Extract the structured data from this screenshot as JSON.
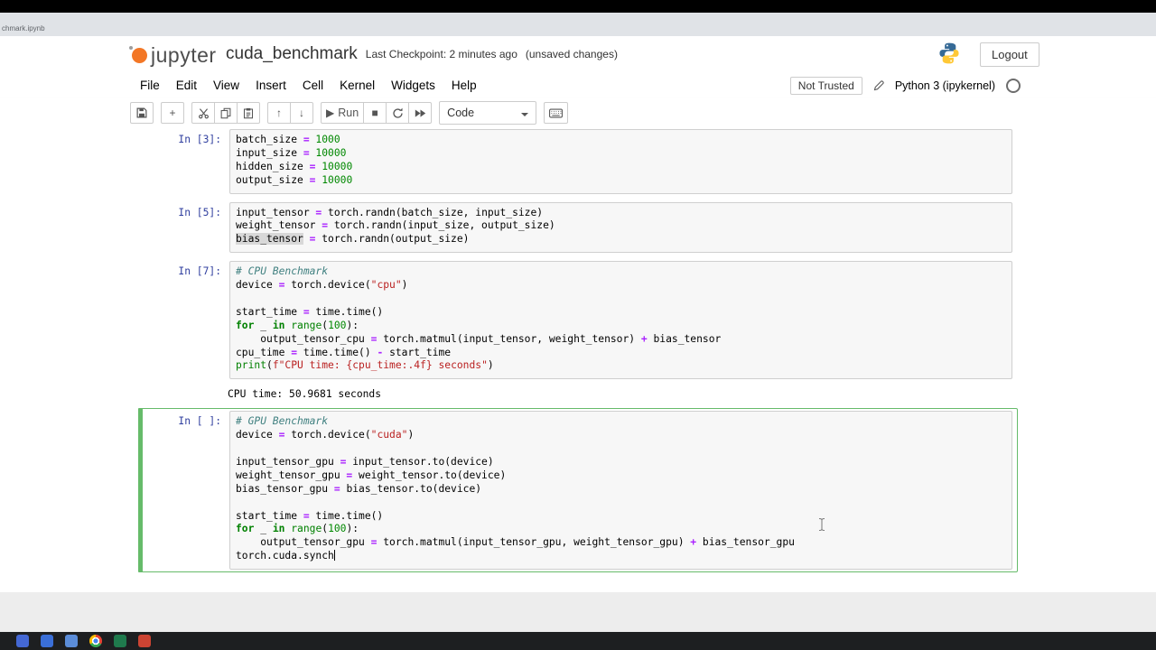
{
  "chrome": {
    "tab_label": "chmark.ipynb"
  },
  "header": {
    "logo_text": "jupyter",
    "title": "cuda_benchmark",
    "checkpoint": "Last Checkpoint: 2 minutes ago",
    "unsaved": "(unsaved changes)",
    "logout_label": "Logout"
  },
  "menu": {
    "items": [
      "File",
      "Edit",
      "View",
      "Insert",
      "Cell",
      "Kernel",
      "Widgets",
      "Help"
    ],
    "trusted_label": "Not Trusted",
    "kernel_name": "Python 3 (ipykernel)"
  },
  "toolbar": {
    "groups": [
      [
        {
          "name": "save-button",
          "icon": "floppy"
        }
      ],
      [
        {
          "name": "insert-cell-button",
          "icon": "plus"
        }
      ],
      [
        {
          "name": "cut-cells-button",
          "icon": "scissors"
        },
        {
          "name": "copy-cells-button",
          "icon": "copy"
        },
        {
          "name": "paste-cells-button",
          "icon": "paste"
        }
      ],
      [
        {
          "name": "move-cell-up-button",
          "icon": "arrow-up"
        },
        {
          "name": "move-cell-down-button",
          "icon": "arrow-down"
        }
      ],
      [
        {
          "name": "run-button",
          "icon": "play",
          "label": "Run"
        },
        {
          "name": "interrupt-kernel-button",
          "icon": "stop"
        },
        {
          "name": "restart-kernel-button",
          "icon": "refresh"
        },
        {
          "name": "restart-run-all-button",
          "icon": "fast-forward"
        }
      ],
      [
        {
          "name": "cell-type-select",
          "type": "select",
          "label": "Code"
        }
      ],
      [
        {
          "name": "command-palette-button",
          "icon": "keyboard"
        }
      ]
    ]
  },
  "colors": {
    "edit_mode_border": "#66BB6A",
    "prompt_blue": "#303F9F",
    "jupyter_orange": "#F37726",
    "keyword_green": "#008000",
    "string_red": "#BA2121",
    "number_green": "#008800",
    "operator_purple": "#AA22FF",
    "comment_teal": "#408080"
  },
  "notebook": {
    "cells": [
      {
        "prompt": "In [3]:",
        "lines": [
          [
            [
              "v",
              "batch_size"
            ],
            [
              "o",
              " = "
            ],
            [
              "n",
              "1000"
            ]
          ],
          [
            [
              "v",
              "input_size"
            ],
            [
              "o",
              " = "
            ],
            [
              "n",
              "10000"
            ]
          ],
          [
            [
              "v",
              "hidden_size"
            ],
            [
              "o",
              " = "
            ],
            [
              "n",
              "10000"
            ]
          ],
          [
            [
              "v",
              "output_size"
            ],
            [
              "o",
              " = "
            ],
            [
              "n",
              "10000"
            ]
          ]
        ]
      },
      {
        "prompt": "In [5]:",
        "lines": [
          [
            [
              "v",
              "input_tensor"
            ],
            [
              "o",
              " = "
            ],
            [
              "v",
              "torch.randn(batch_size, input_size)"
            ]
          ],
          [
            [
              "v",
              "weight_tensor"
            ],
            [
              "o",
              " = "
            ],
            [
              "v",
              "torch.randn(input_size, output_size)"
            ]
          ],
          [
            [
              "hl",
              "bias_tensor"
            ],
            [
              "o",
              " = "
            ],
            [
              "v",
              "torch.randn(output_size)"
            ]
          ]
        ]
      },
      {
        "prompt": "In [7]:",
        "lines": [
          [
            [
              "c",
              "# CPU Benchmark"
            ]
          ],
          [
            [
              "v",
              "device"
            ],
            [
              "o",
              " = "
            ],
            [
              "v",
              "torch.device("
            ],
            [
              "s",
              "\"cpu\""
            ],
            [
              "v",
              ")"
            ]
          ],
          [],
          [
            [
              "v",
              "start_time"
            ],
            [
              "o",
              " = "
            ],
            [
              "v",
              "time.time()"
            ]
          ],
          [
            [
              "k",
              "for"
            ],
            [
              "v",
              " _ "
            ],
            [
              "k",
              "in"
            ],
            [
              "v",
              " "
            ],
            [
              "b",
              "range"
            ],
            [
              "v",
              "("
            ],
            [
              "n",
              "100"
            ],
            [
              "v",
              "):"
            ]
          ],
          [
            [
              "v",
              "    output_tensor_cpu"
            ],
            [
              "o",
              " = "
            ],
            [
              "v",
              "torch.matmul(input_tensor, weight_tensor)"
            ],
            [
              "o",
              " + "
            ],
            [
              "v",
              "bias_tensor"
            ]
          ],
          [
            [
              "v",
              "cpu_time"
            ],
            [
              "o",
              " = "
            ],
            [
              "v",
              "time.time()"
            ],
            [
              "o",
              " - "
            ],
            [
              "v",
              "start_time"
            ]
          ],
          [
            [
              "b",
              "print"
            ],
            [
              "v",
              "("
            ],
            [
              "s",
              "f\"CPU time: {cpu_time:.4f} seconds\""
            ],
            [
              "v",
              ")"
            ]
          ]
        ],
        "output": "CPU time: 50.9681 seconds"
      },
      {
        "prompt": "In [ ]:",
        "selected": true,
        "cursor": true,
        "lines": [
          [
            [
              "c",
              "# GPU Benchmark"
            ]
          ],
          [
            [
              "v",
              "device"
            ],
            [
              "o",
              " = "
            ],
            [
              "v",
              "torch.device("
            ],
            [
              "s",
              "\"cuda\""
            ],
            [
              "v",
              ")"
            ]
          ],
          [],
          [
            [
              "v",
              "input_tensor_gpu"
            ],
            [
              "o",
              " = "
            ],
            [
              "v",
              "input_tensor.to(device)"
            ]
          ],
          [
            [
              "v",
              "weight_tensor_gpu"
            ],
            [
              "o",
              " = "
            ],
            [
              "v",
              "weight_tensor.to(device)"
            ]
          ],
          [
            [
              "v",
              "bias_tensor_gpu"
            ],
            [
              "o",
              " = "
            ],
            [
              "v",
              "bias_tensor.to(device)"
            ]
          ],
          [],
          [
            [
              "v",
              "start_time"
            ],
            [
              "o",
              " = "
            ],
            [
              "v",
              "time.time()"
            ]
          ],
          [
            [
              "k",
              "for"
            ],
            [
              "v",
              " _ "
            ],
            [
              "k",
              "in"
            ],
            [
              "v",
              " "
            ],
            [
              "b",
              "range"
            ],
            [
              "v",
              "("
            ],
            [
              "n",
              "100"
            ],
            [
              "v",
              "):"
            ]
          ],
          [
            [
              "v",
              "    output_tensor_gpu"
            ],
            [
              "o",
              " = "
            ],
            [
              "v",
              "torch.matmul(input_tensor_gpu, weight_tensor_gpu)"
            ],
            [
              "o",
              " + "
            ],
            [
              "v",
              "bias_tensor_gpu"
            ]
          ],
          [
            [
              "v",
              "torch.cuda.synch"
            ]
          ]
        ]
      }
    ]
  },
  "taskbar": {
    "apps": [
      {
        "name": "app-1",
        "color": "#4468d4"
      },
      {
        "name": "app-2",
        "color": "#3a6fd8"
      },
      {
        "name": "app-3",
        "color": "#5b8dd9"
      },
      {
        "name": "chrome-browser",
        "kind": "chrome"
      },
      {
        "name": "app-5",
        "color": "#1f7a4d"
      },
      {
        "name": "app-6",
        "color": "#cc4433"
      }
    ]
  }
}
